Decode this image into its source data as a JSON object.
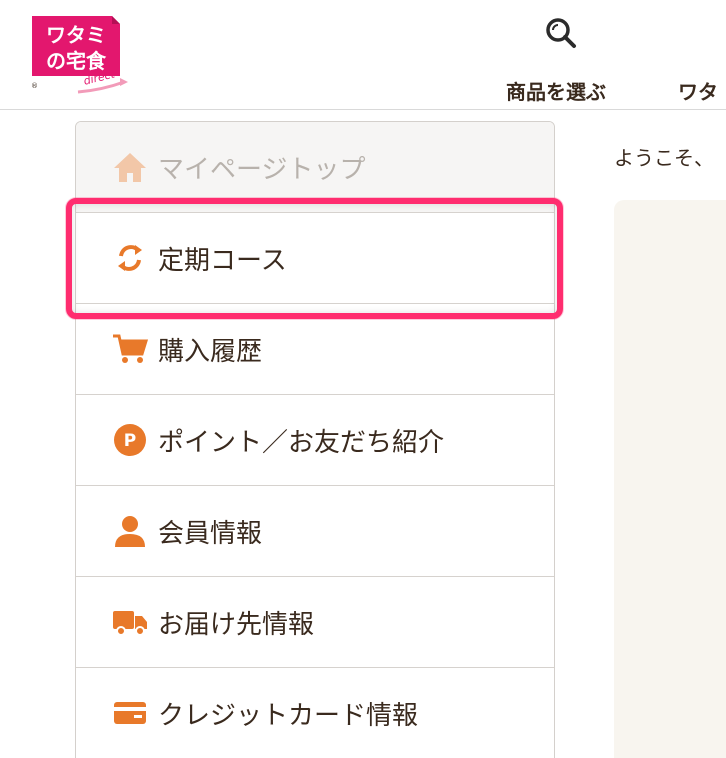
{
  "header": {
    "logo": {
      "line1": "ワタミ",
      "line2": "の宅食",
      "tagline": "direct",
      "registered_mark": "®",
      "colors": {
        "primary": "#e3176e",
        "accent": "#f29bb9"
      }
    },
    "search_icon": "search-icon",
    "nav": {
      "products": "商品を選ぶ",
      "watami": "ワタ"
    }
  },
  "sidebar": {
    "items": [
      {
        "label": "マイページトップ",
        "icon": "home-icon"
      },
      {
        "label": "定期コース",
        "icon": "refresh-icon"
      },
      {
        "label": "購入履歴",
        "icon": "cart-icon"
      },
      {
        "label": "ポイント／お友だち紹介",
        "icon": "point-icon",
        "icon_text": "P"
      },
      {
        "label": "会員情報",
        "icon": "user-icon"
      },
      {
        "label": "お届け先情報",
        "icon": "truck-icon"
      },
      {
        "label": "クレジットカード情報",
        "icon": "credit-card-icon"
      }
    ],
    "highlighted_index": 1
  },
  "main": {
    "welcome": "ようこそ、"
  },
  "colors": {
    "accent_orange": "#e8792a",
    "home_icon": "#f2c7a8",
    "highlight": "#ff2d6f",
    "text": "#3a2a1e",
    "panel_bg": "#f8f5ef"
  }
}
